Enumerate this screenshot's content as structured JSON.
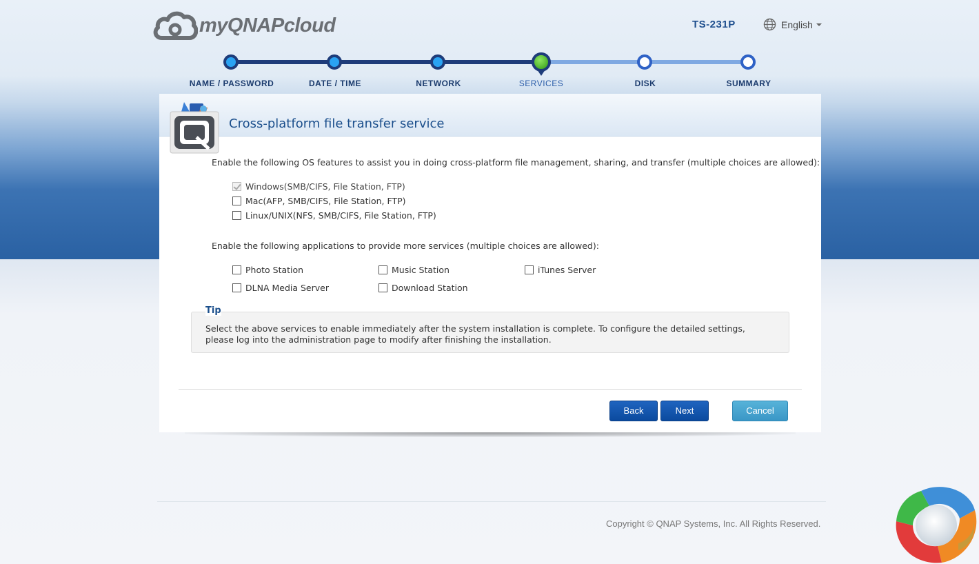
{
  "header": {
    "logo_text": "myQNAPcloud",
    "model": "TS-231P",
    "language": "English"
  },
  "steps": [
    {
      "label": "NAME / PASSWORD",
      "state": "done"
    },
    {
      "label": "DATE / TIME",
      "state": "done"
    },
    {
      "label": "NETWORK",
      "state": "done"
    },
    {
      "label": "SERVICES",
      "state": "current"
    },
    {
      "label": "DISK",
      "state": "todo"
    },
    {
      "label": "SUMMARY",
      "state": "todo"
    }
  ],
  "card": {
    "title": "Cross-platform file transfer service",
    "os_intro": "Enable the following OS features to assist you in doing cross-platform file management, sharing, and transfer (multiple choices are allowed):",
    "os_options": [
      {
        "label": "Windows(SMB/CIFS, File Station, FTP)",
        "checked": true,
        "disabled": true
      },
      {
        "label": "Mac(AFP, SMB/CIFS, File Station, FTP)",
        "checked": false
      },
      {
        "label": "Linux/UNIX(NFS, SMB/CIFS, File Station, FTP)",
        "checked": false
      }
    ],
    "apps_intro": "Enable the following applications to provide more services (multiple choices are allowed):",
    "apps": [
      {
        "label": "Photo Station",
        "checked": false
      },
      {
        "label": "Music Station",
        "checked": false
      },
      {
        "label": "iTunes Server",
        "checked": false
      },
      {
        "label": "DLNA Media Server",
        "checked": false
      },
      {
        "label": "Download Station",
        "checked": false
      }
    ],
    "tip_title": "Tip",
    "tip_text": "Select the above services to enable immediately after the system installation is complete. To configure the detailed settings, please log into the administration page to modify after finishing the installation.",
    "buttons": {
      "back": "Back",
      "next": "Next",
      "cancel": "Cancel"
    }
  },
  "footer": {
    "copyright": "Copyright © QNAP Systems, Inc. All Rights Reserved."
  },
  "colors": {
    "primary_button": "#0b4a9e",
    "cancel_button": "#3a97c6",
    "stepper_done": "#1e3c7a",
    "stepper_todo": "#7fa9e2",
    "current_step": "#2f9a14"
  }
}
